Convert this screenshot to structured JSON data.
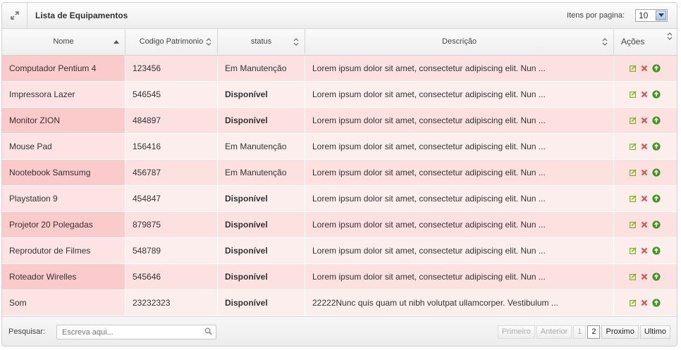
{
  "header": {
    "title": "Lista de Equipamentos",
    "per_page_label": "Itens por pagina:",
    "per_page_value": "10"
  },
  "columns": [
    {
      "label": "Nome",
      "sort": "asc"
    },
    {
      "label": "Codigo Patrimonio",
      "sort": "both"
    },
    {
      "label": "status",
      "sort": "both"
    },
    {
      "label": "Descrição",
      "sort": "both"
    },
    {
      "label": "Ações",
      "sort": "both"
    }
  ],
  "rows": [
    {
      "nome": "Computador Pentium 4",
      "codigo": "123456",
      "status": "Em Manutenção",
      "status_bold": false,
      "descricao": "Lorem ipsum dolor sit amet, consectetur adipiscing elit. Nun ..."
    },
    {
      "nome": "Impressora Lazer",
      "codigo": "546545",
      "status": "Disponível",
      "status_bold": true,
      "descricao": "Lorem ipsum dolor sit amet, consectetur adipiscing elit. Nun ..."
    },
    {
      "nome": "Monitor ZION",
      "codigo": "484897",
      "status": "Disponível",
      "status_bold": true,
      "descricao": "Lorem ipsum dolor sit amet, consectetur adipiscing elit. Nun ..."
    },
    {
      "nome": "Mouse Pad",
      "codigo": "156416",
      "status": "Em Manutenção",
      "status_bold": false,
      "descricao": "Lorem ipsum dolor sit amet, consectetur adipiscing elit. Nun ..."
    },
    {
      "nome": "Nootebook Samsumg",
      "codigo": "456787",
      "status": "Em Manutenção",
      "status_bold": false,
      "descricao": "Lorem ipsum dolor sit amet, consectetur adipiscing elit. Nun ..."
    },
    {
      "nome": "Playstation 9",
      "codigo": "454847",
      "status": "Disponível",
      "status_bold": true,
      "descricao": "Lorem ipsum dolor sit amet, consectetur adipiscing elit. Nun ..."
    },
    {
      "nome": "Projetor 20 Polegadas",
      "codigo": "879875",
      "status": "Disponível",
      "status_bold": true,
      "descricao": "Lorem ipsum dolor sit amet, consectetur adipiscing elit. Nun ..."
    },
    {
      "nome": "Reprodutor de Filmes",
      "codigo": "548789",
      "status": "Disponível",
      "status_bold": true,
      "descricao": "Lorem ipsum dolor sit amet, consectetur adipiscing elit. Nun ..."
    },
    {
      "nome": "Roteador Wirelles",
      "codigo": "545646",
      "status": "Disponível",
      "status_bold": true,
      "descricao": "Lorem ipsum dolor sit amet, consectetur adipiscing elit. Nun ..."
    },
    {
      "nome": "Som",
      "codigo": "23232323",
      "status": "Disponível",
      "status_bold": true,
      "descricao": "22222Nunc quis quam ut nibh volutpat ullamcorper. Vestibulum ..."
    }
  ],
  "row_actions": [
    "edit-icon",
    "delete-icon",
    "upload-icon"
  ],
  "footer": {
    "search_label": "Pesquisar:",
    "search_placeholder": "Escreva aqui...",
    "search_value": "",
    "pager": {
      "first": "Primeiro",
      "prev": "Anterior",
      "pages": [
        "1",
        "2"
      ],
      "current_page": "2",
      "next": "Proximo",
      "last": "Ultimo"
    }
  },
  "colors": {
    "row_odd": "#fde0e0",
    "row_even": "#fdeeee",
    "edit": "#7cb518",
    "delete": "#d9534f",
    "upload": "#3c9a1e"
  }
}
